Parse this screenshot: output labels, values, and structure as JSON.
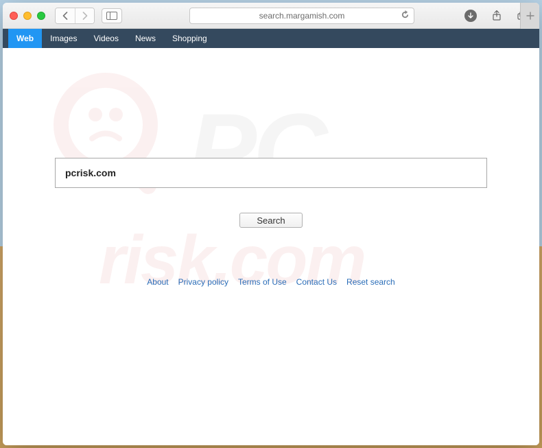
{
  "browser": {
    "url": "search.margamish.com"
  },
  "top_nav": {
    "items": [
      {
        "label": "Web",
        "active": true
      },
      {
        "label": "Images",
        "active": false
      },
      {
        "label": "Videos",
        "active": false
      },
      {
        "label": "News",
        "active": false
      },
      {
        "label": "Shopping",
        "active": false
      }
    ]
  },
  "search": {
    "value": "pcrisk.com",
    "button_label": "Search"
  },
  "footer": {
    "links": [
      "About",
      "Privacy policy",
      "Terms of Use",
      "Contact Us",
      "Reset search"
    ]
  },
  "watermark": {
    "line1": "PC",
    "line2": "risk.com"
  }
}
